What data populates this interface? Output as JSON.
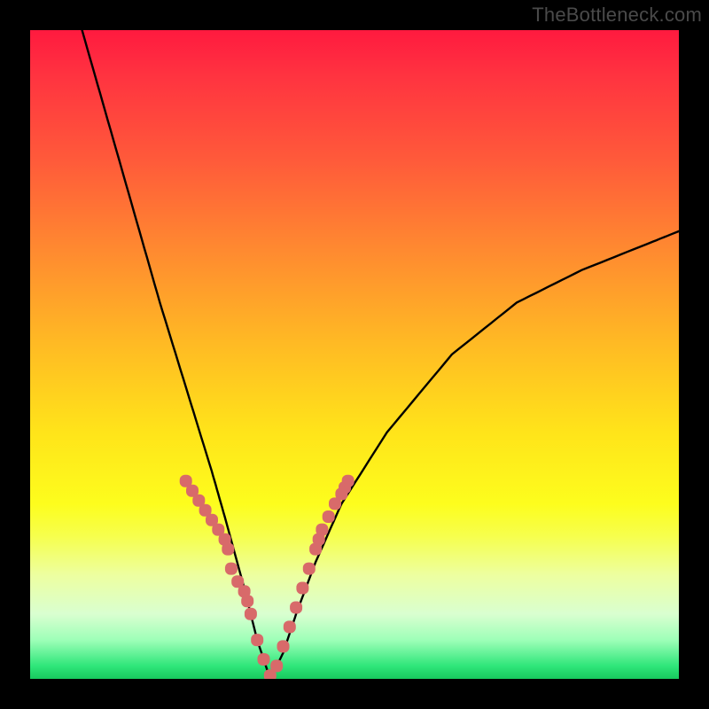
{
  "watermark": "TheBottleneck.com",
  "colors": {
    "curve_stroke": "#000000",
    "marker_fill": "#d86a6a",
    "background_border": "#000000"
  },
  "chart_data": {
    "type": "line",
    "title": "",
    "xlabel": "",
    "ylabel": "",
    "xlim": [
      0,
      100
    ],
    "ylim": [
      0,
      100
    ],
    "notes": "V-shaped bottleneck curve on a vertical red→green heat gradient. Minimum (bottom of V) is near x≈37, y≈0. Markers highlight the lower 30% of the curve on both arms.",
    "series": [
      {
        "name": "bottleneck-curve",
        "x": [
          8,
          12,
          16,
          20,
          24,
          28,
          30,
          33,
          35,
          37,
          39,
          41,
          44,
          48,
          55,
          65,
          75,
          85,
          95,
          100
        ],
        "y": [
          100,
          86,
          72,
          58,
          45,
          32,
          25,
          14,
          6,
          0,
          4,
          10,
          18,
          27,
          38,
          50,
          58,
          63,
          67,
          69
        ]
      }
    ],
    "markers": {
      "name": "highlight-points",
      "x": [
        24,
        25,
        26,
        27,
        28,
        29,
        30,
        30.5,
        31,
        32,
        33,
        33.5,
        34,
        35,
        36,
        37,
        38,
        39,
        40,
        41,
        42,
        43,
        44,
        44.5,
        45,
        46,
        47,
        48,
        48.5,
        49
      ],
      "y": [
        30.5,
        29,
        27.5,
        26,
        24.5,
        23,
        21.5,
        20,
        17,
        15,
        13.5,
        12,
        10,
        6,
        3,
        0.5,
        2,
        5,
        8,
        11,
        14,
        17,
        20,
        21.5,
        23,
        25,
        27,
        28.5,
        29.5,
        30.5
      ]
    }
  }
}
